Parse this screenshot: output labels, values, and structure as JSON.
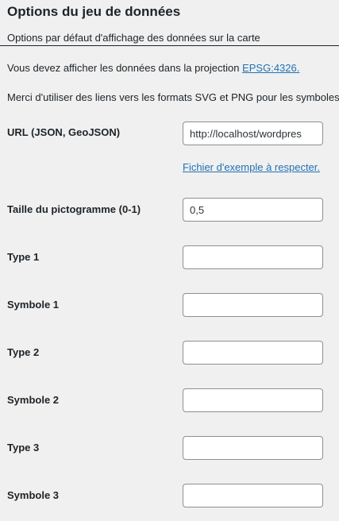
{
  "section": {
    "title": "Options du jeu de données",
    "subtitle": "Options par défaut d'affichage des données sur la carte"
  },
  "notices": {
    "projection_text": "Vous devez afficher les données dans la projection ",
    "projection_link": "EPSG:4326.",
    "symbols_text": "Merci d'utiliser des liens vers les formats SVG et PNG pour les symboles."
  },
  "fields": {
    "url": {
      "label": "URL (JSON, GeoJSON)",
      "value": "http://localhost/wordpres",
      "example_link": "Fichier d'exemple à respecter."
    },
    "icon_size": {
      "label": "Taille du pictogramme (0-1)",
      "value": "0,5"
    },
    "type1": {
      "label": "Type 1",
      "value": ""
    },
    "symbol1": {
      "label": "Symbole 1",
      "value": ""
    },
    "type2": {
      "label": "Type 2",
      "value": ""
    },
    "symbol2": {
      "label": "Symbole 2",
      "value": ""
    },
    "type3": {
      "label": "Type 3",
      "value": ""
    },
    "symbol3": {
      "label": "Symbole 3",
      "value": ""
    }
  },
  "colors": {
    "background": "#f0f0f1",
    "text": "#1d2327",
    "link": "#2271b1",
    "input_border": "#8c8f94"
  }
}
